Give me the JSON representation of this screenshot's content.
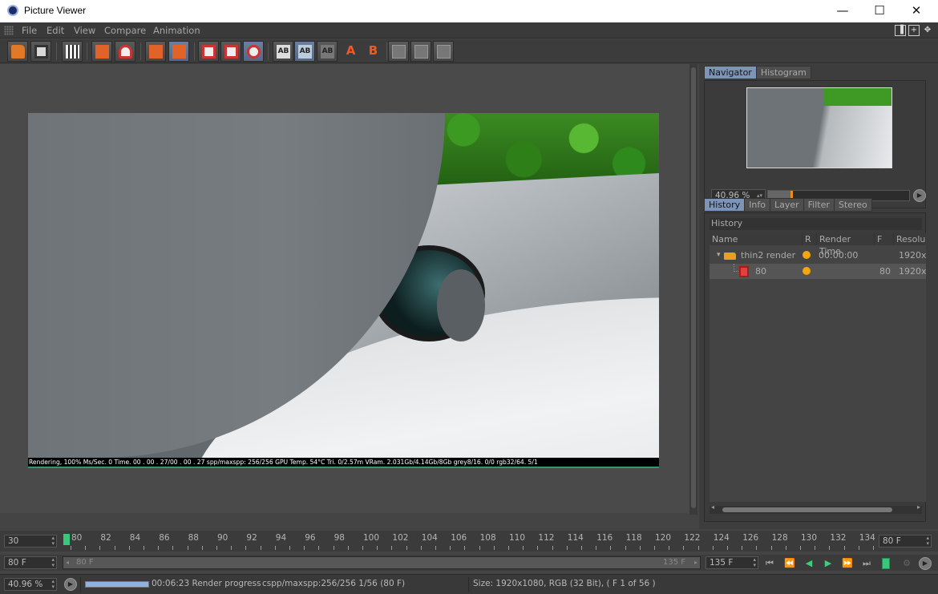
{
  "window": {
    "title": "Picture Viewer",
    "minimize": "—",
    "maximize": "☐",
    "close": "✕"
  },
  "menu": [
    "File",
    "Edit",
    "View",
    "Compare",
    "Animation"
  ],
  "render": {
    "status_line": "Rendering, 100% Ms/Sec. 0 Time. 00 . 00 . 27/00 . 00 . 27 spp/maxspp: 256/256 GPU  Temp. 54°C Tri. 0/2.57m VRam. 2.031Gb/4.14Gb/8Gb grey8/16. 0/0 rgb32/64. 5/1"
  },
  "navigator": {
    "tabs": [
      "Navigator",
      "Histogram"
    ],
    "zoom_value": "40.96 %",
    "zoom_fraction": 0.16
  },
  "history": {
    "tabs": [
      "History",
      "Info",
      "Layer",
      "Filter",
      "Stereo"
    ],
    "section_title": "History",
    "columns": [
      "Name",
      "R",
      "Render Time",
      "F",
      "Resolu"
    ],
    "rows": [
      {
        "name": "thin2 render",
        "render_time": "00:00:00",
        "frame": "",
        "resolution": "1920x"
      },
      {
        "name": "80",
        "render_time": "",
        "frame": "80",
        "resolution": "1920x"
      }
    ]
  },
  "timeline": {
    "start_field": "30",
    "end_field": "80 F",
    "ticks": [
      "80",
      "82",
      "84",
      "86",
      "88",
      "90",
      "92",
      "94",
      "96",
      "98",
      "100",
      "102",
      "104",
      "106",
      "108",
      "110",
      "112",
      "114",
      "116",
      "118",
      "120",
      "122",
      "124",
      "126",
      "128",
      "130",
      "132",
      "134"
    ],
    "current_frame": 80
  },
  "range": {
    "min_field": "80 F",
    "track_start": "80 F",
    "track_end": "135 F",
    "max_field": "135 F"
  },
  "status": {
    "zoom": "40.96 %",
    "progress_fraction": 1.0,
    "progress_text": "00:06:23 Render progress",
    "samples": "cspp/maxspp:256/256 1/56 (80 F)",
    "size_info": "Size: 1920x1080, RGB (32 Bit),  ( F 1 of 56 )"
  },
  "colors": {
    "accent_tab": "#7d94b9",
    "playhead": "#3bc77a",
    "status_dot": "#f5a60c"
  }
}
